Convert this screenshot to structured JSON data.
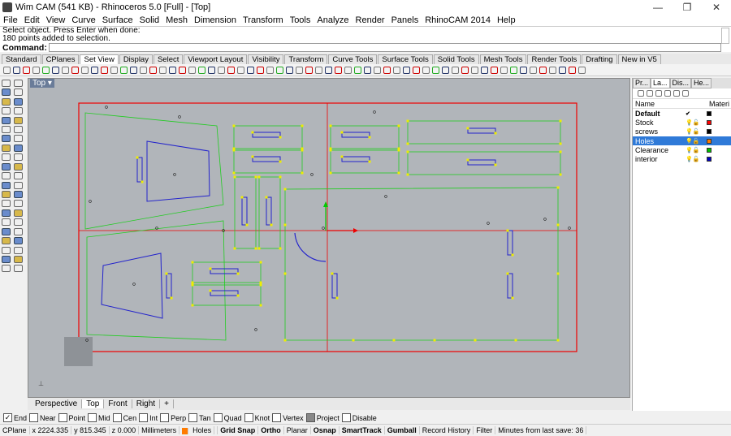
{
  "window": {
    "title": "Wim CAM (541 KB) - Rhinoceros 5.0 [Full] - [Top]",
    "minimize": "—",
    "maximize": "❐",
    "close": "✕"
  },
  "menu": [
    "File",
    "Edit",
    "View",
    "Curve",
    "Surface",
    "Solid",
    "Mesh",
    "Dimension",
    "Transform",
    "Tools",
    "Analyze",
    "Render",
    "Panels",
    "RhinoCAM 2014",
    "Help"
  ],
  "command_history": [
    "Select object. Press Enter when done:",
    "180 points added to selection."
  ],
  "command_prompt": "Command:",
  "toolbar_tabs": [
    "Standard",
    "CPlanes",
    "Set View",
    "Display",
    "Select",
    "Viewport Layout",
    "Visibility",
    "Transform",
    "Curve Tools",
    "Surface Tools",
    "Solid Tools",
    "Mesh Tools",
    "Render Tools",
    "Drafting",
    "New in V5"
  ],
  "active_toolbar_tab": "Set View",
  "viewport": {
    "label": "Top",
    "dropdown": "▾"
  },
  "view_tabs": [
    "Perspective",
    "Top",
    "Front",
    "Right",
    "+"
  ],
  "active_view_tab": "Top",
  "panel": {
    "tabs": [
      "Pr...",
      "La...",
      "Dis...",
      "He..."
    ],
    "active_tab": "La...",
    "col_name": "Name",
    "col_material": "Materi",
    "layers": [
      {
        "name": "Default",
        "check": "✔",
        "color": "#000000",
        "bold": true,
        "selected": false
      },
      {
        "name": "Stock",
        "check": "",
        "color": "#ff0000",
        "bold": false,
        "selected": false
      },
      {
        "name": "screws",
        "check": "",
        "color": "#000000",
        "bold": false,
        "selected": false
      },
      {
        "name": "Holes",
        "check": "",
        "color": "#ff7b00",
        "bold": false,
        "selected": true
      },
      {
        "name": "Clearance",
        "check": "",
        "color": "#00c000",
        "bold": false,
        "selected": false
      },
      {
        "name": "interior",
        "check": "",
        "color": "#0000c0",
        "bold": false,
        "selected": false
      }
    ]
  },
  "osnaps": [
    {
      "label": "End",
      "checked": true
    },
    {
      "label": "Near",
      "checked": false
    },
    {
      "label": "Point",
      "checked": false
    },
    {
      "label": "Mid",
      "checked": false
    },
    {
      "label": "Cen",
      "checked": false
    },
    {
      "label": "Int",
      "checked": false
    },
    {
      "label": "Perp",
      "checked": false
    },
    {
      "label": "Tan",
      "checked": false
    },
    {
      "label": "Quad",
      "checked": false
    },
    {
      "label": "Knot",
      "checked": false
    },
    {
      "label": "Vertex",
      "checked": false
    },
    {
      "label": "Project",
      "checked": false
    },
    {
      "label": "Disable",
      "checked": false
    }
  ],
  "status": {
    "cplane": "CPlane",
    "x": "x 2224.335",
    "y": "y 815.345",
    "z": "z 0.000",
    "units": "Millimeters",
    "layer": "Holes",
    "grid_snap": "Grid Snap",
    "ortho": "Ortho",
    "planar": "Planar",
    "osnap": "Osnap",
    "smarttrack": "SmartTrack",
    "gumball": "Gumball",
    "record_history": "Record History",
    "filter": "Filter",
    "last_save": "Minutes from last save: 36"
  }
}
